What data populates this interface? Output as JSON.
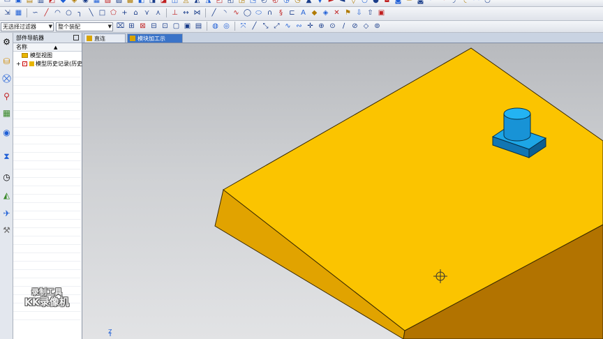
{
  "toolbar": {
    "selection_filter": "无选择过滤器",
    "assembly_scope": "整个装配"
  },
  "tabs": [
    {
      "label": "直连型.prt"
    },
    {
      "label": "模块加工示范.prt"
    }
  ],
  "navigator": {
    "title": "部件导航器",
    "column_header": "名称",
    "items": [
      {
        "label": "模型视图"
      },
      {
        "label": "模型历史记录(历史"
      }
    ]
  },
  "watermark": {
    "line1": "录制工具",
    "line2": "KK录像机"
  },
  "colors": {
    "block_top": "#fbc400",
    "block_left": "#e1a300",
    "block_front": "#b27300",
    "boss": "#1da6e6",
    "viewport_bg": "#cfd1d4",
    "active_tab": "#3a73c8"
  },
  "axis": {
    "label": "Z"
  }
}
